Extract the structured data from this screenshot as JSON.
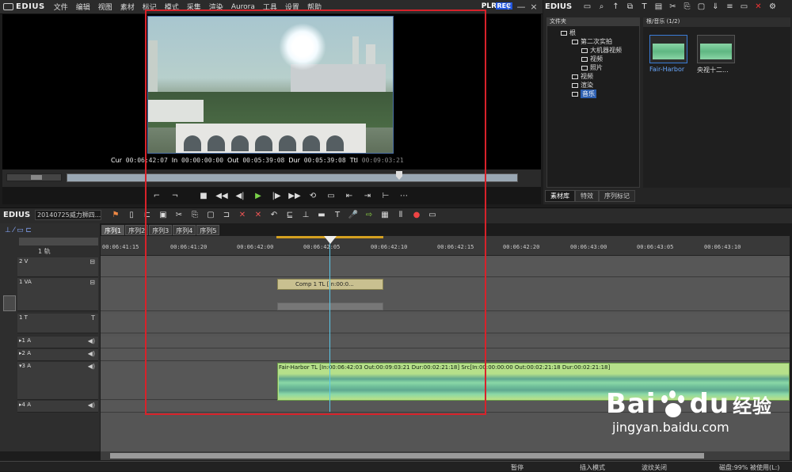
{
  "app": {
    "name": "EDIUS",
    "plr": "PLR",
    "rec": "REC"
  },
  "menu": [
    "文件",
    "编辑",
    "视图",
    "素材",
    "标记",
    "模式",
    "采集",
    "渲染",
    "Aurora",
    "工具",
    "设置",
    "帮助"
  ],
  "window_buttons": [
    "?",
    "—",
    "×"
  ],
  "player": {
    "cur_label": "Cur",
    "cur": "00:06:42:07",
    "in_label": "In",
    "in": "00:00:00:00",
    "out_label": "Out",
    "out": "00:05:39:08",
    "dur_label": "Dur",
    "dur": "00:05:39:08",
    "ttl_label": "Ttl",
    "ttl": "00:09:03:21"
  },
  "bin": {
    "title": "EDIUS",
    "folder_header": "文件夹",
    "clip_header": "根/音乐 (1/2)",
    "tree": [
      "根",
      "第二次实拍",
      "大机器视频",
      "视频",
      "照片",
      "视频",
      "渲染",
      "音乐"
    ],
    "clips": [
      "Fair-Harbor",
      "央视十二..."
    ],
    "tabs": [
      "素材库",
      "特效",
      "序列标记"
    ]
  },
  "timeline": {
    "title": "EDIUS",
    "sequence_name": "20140725威力狮四...",
    "sequence_tabs": [
      "序列1",
      "序列2",
      "序列3",
      "序列4",
      "序列5"
    ],
    "ruler_ticks": [
      "00:06:41:15",
      "00:06:41:20",
      "00:06:42:00",
      "00:06:42:05",
      "00:06:42:10",
      "00:06:42:15",
      "00:06:42:20",
      "00:06:43:00",
      "00:06:43:05",
      "00:06:43:10"
    ],
    "track_header_top": "1 轨",
    "tracks": {
      "v2": "2 V",
      "va1": "1 VA",
      "t1": "1 T",
      "a1": "▸1 A",
      "a2": "▸2 A",
      "a3": "▾3 A",
      "a4": "▸4 A"
    },
    "va_clip": "Comp 1   TL [In:00:0...",
    "audio_clip": "Fair-Harbor  TL [In:00:06:42:03 Out:00:09:03:21 Dur:00:02:21:18] Src[In:00:00:00:00 Out:00:02:21:18 Dur:00:02:21:18]"
  },
  "status": {
    "mode": "暂停",
    "insert": "插入模式",
    "ripple": "波纹关闭",
    "disk": "磁盘:99% 被使用(L:)"
  },
  "watermark": {
    "brand": "Bai",
    "brand2": "du",
    "cn": "经验",
    "url": "jingyan.baidu.com"
  }
}
